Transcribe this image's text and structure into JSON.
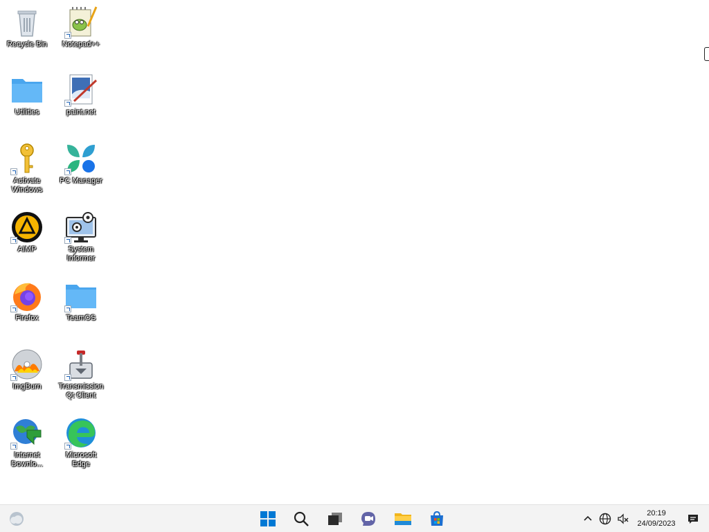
{
  "desktop": {
    "icons": [
      {
        "label": "Recycle Bin"
      },
      {
        "label": "Notepad++"
      },
      {
        "label": "Utilities"
      },
      {
        "label": "paint.net"
      },
      {
        "label": "Activate\nWindows"
      },
      {
        "label": "PC Manager"
      },
      {
        "label": "AIMP"
      },
      {
        "label": "System\nInformer"
      },
      {
        "label": "Firefox"
      },
      {
        "label": "TeamOS"
      },
      {
        "label": "ImgBurn"
      },
      {
        "label": "Transmission\nQt Client"
      },
      {
        "label": "Internet\nDownlo..."
      },
      {
        "label": "Microsoft\nEdge"
      }
    ]
  },
  "taskbar": {
    "apps": [
      "start",
      "search",
      "task-view",
      "chat",
      "file-explorer",
      "microsoft-store"
    ],
    "tray": {
      "time": "20:19",
      "date": "24/09/2023"
    }
  },
  "colors": {
    "desktop_bg": "#ffffff",
    "taskbar_bg": "#f3f3f3",
    "accent": "#0067c0"
  }
}
